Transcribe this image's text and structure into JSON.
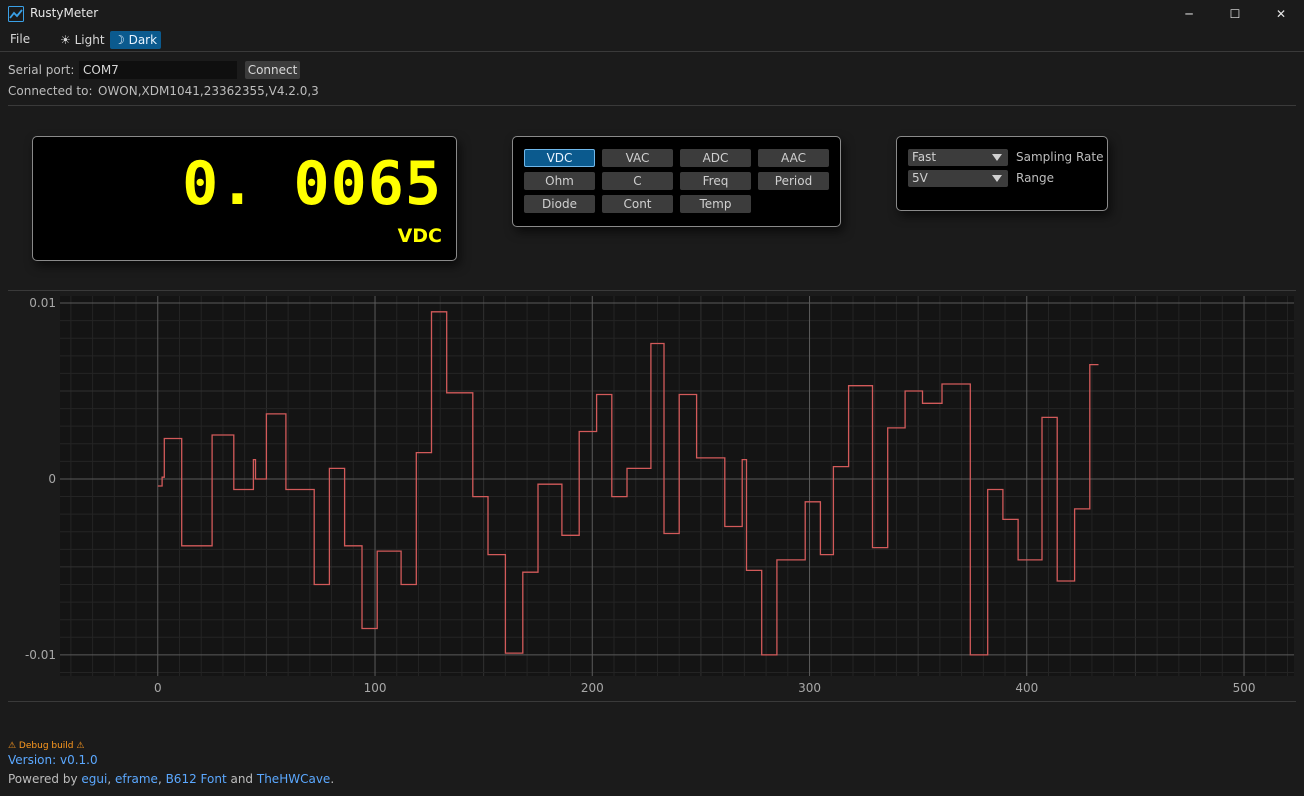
{
  "window": {
    "title": "RustyMeter",
    "minimize_glyph": "─",
    "maximize_glyph": "☐",
    "close_glyph": "✕"
  },
  "menu": {
    "file": "File",
    "light": "☀ Light",
    "dark": "☽ Dark"
  },
  "connection": {
    "serial_label": "Serial port:",
    "serial_value": "COM7",
    "connect_label": "Connect",
    "connected_label": "Connected to:",
    "connected_value": "OWON,XDM1041,23362355,V4.2.0,3"
  },
  "reading": {
    "value": "0. 0065",
    "unit": "VDC",
    "color": "#ffff00"
  },
  "modes": [
    {
      "label": "VDC",
      "active": true
    },
    {
      "label": "VAC",
      "active": false
    },
    {
      "label": "ADC",
      "active": false
    },
    {
      "label": "AAC",
      "active": false
    },
    {
      "label": "Ohm",
      "active": false
    },
    {
      "label": "C",
      "active": false
    },
    {
      "label": "Freq",
      "active": false
    },
    {
      "label": "Period",
      "active": false
    },
    {
      "label": "Diode",
      "active": false
    },
    {
      "label": "Cont",
      "active": false
    },
    {
      "label": "Temp",
      "active": false
    }
  ],
  "settings": {
    "sampling_rate_value": "Fast",
    "sampling_rate_label": "Sampling Rate",
    "range_value": "5V",
    "range_label": "Range"
  },
  "footer": {
    "debug_build": "⚠ Debug build ⚠",
    "version": "Version: v0.1.0",
    "powered_prefix": "Powered by ",
    "egui": "egui",
    "comma1": ", ",
    "eframe": "eframe",
    "comma2": ", ",
    "b612": "B612 Font",
    "and": " and ",
    "thehwcave": "TheHWCave",
    "period": "."
  },
  "chart_data": {
    "type": "line",
    "series": [
      {
        "color": "#d25a5a",
        "points": [
          [
            0,
            -0.0004
          ],
          [
            2,
            -0.0004
          ],
          [
            2,
            0.0001
          ],
          [
            3,
            0.0001
          ],
          [
            3,
            0.0023
          ],
          [
            11,
            0.0023
          ],
          [
            11,
            -0.0038
          ],
          [
            25,
            -0.0038
          ],
          [
            25,
            0.0025
          ],
          [
            35,
            0.0025
          ],
          [
            35,
            -0.0006
          ],
          [
            42,
            -0.0006
          ],
          [
            42,
            -0.0006
          ],
          [
            44,
            -0.0006
          ],
          [
            44,
            0.0011
          ],
          [
            45,
            0.0011
          ],
          [
            45,
            0.0
          ],
          [
            50,
            0.0
          ],
          [
            50,
            0.0037
          ],
          [
            59,
            0.0037
          ],
          [
            59,
            -0.0006
          ],
          [
            72,
            -0.0006
          ],
          [
            72,
            -0.006
          ],
          [
            79,
            -0.006
          ],
          [
            79,
            0.0006
          ],
          [
            86,
            0.0006
          ],
          [
            86,
            -0.0038
          ],
          [
            94,
            -0.0038
          ],
          [
            94,
            -0.0085
          ],
          [
            101,
            -0.0085
          ],
          [
            101,
            -0.0041
          ],
          [
            112,
            -0.0041
          ],
          [
            112,
            -0.006
          ],
          [
            119,
            -0.006
          ],
          [
            119,
            0.0015
          ],
          [
            126,
            0.0015
          ],
          [
            126,
            0.0095
          ],
          [
            133,
            0.0095
          ],
          [
            133,
            0.0049
          ],
          [
            145,
            0.0049
          ],
          [
            145,
            -0.001
          ],
          [
            152,
            -0.001
          ],
          [
            152,
            -0.0043
          ],
          [
            160,
            -0.0043
          ],
          [
            160,
            -0.0099
          ],
          [
            168,
            -0.0099
          ],
          [
            168,
            -0.0053
          ],
          [
            175,
            -0.0053
          ],
          [
            175,
            -0.0003
          ],
          [
            186,
            -0.0003
          ],
          [
            186,
            -0.0032
          ],
          [
            194,
            -0.0032
          ],
          [
            194,
            0.0027
          ],
          [
            202,
            0.0027
          ],
          [
            202,
            0.0048
          ],
          [
            209,
            0.0048
          ],
          [
            209,
            -0.001
          ],
          [
            216,
            -0.001
          ],
          [
            216,
            0.0006
          ],
          [
            227,
            0.0006
          ],
          [
            227,
            0.0077
          ],
          [
            233,
            0.0077
          ],
          [
            233,
            -0.0031
          ],
          [
            240,
            -0.0031
          ],
          [
            240,
            0.0048
          ],
          [
            248,
            0.0048
          ],
          [
            248,
            0.0012
          ],
          [
            261,
            0.0012
          ],
          [
            261,
            -0.0027
          ],
          [
            269,
            -0.0027
          ],
          [
            269,
            0.0011
          ],
          [
            271,
            0.0011
          ],
          [
            271,
            -0.0052
          ],
          [
            278,
            -0.0052
          ],
          [
            278,
            -0.01
          ],
          [
            285,
            -0.01
          ],
          [
            285,
            -0.0046
          ],
          [
            298,
            -0.0046
          ],
          [
            298,
            -0.0013
          ],
          [
            305,
            -0.0013
          ],
          [
            305,
            -0.0043
          ],
          [
            311,
            -0.0043
          ],
          [
            311,
            0.0007
          ],
          [
            318,
            0.0007
          ],
          [
            318,
            0.0053
          ],
          [
            329,
            0.0053
          ],
          [
            329,
            -0.0039
          ],
          [
            336,
            -0.0039
          ],
          [
            336,
            0.0029
          ],
          [
            344,
            0.0029
          ],
          [
            344,
            0.005
          ],
          [
            352,
            0.005
          ],
          [
            352,
            0.0043
          ],
          [
            361,
            0.0043
          ],
          [
            361,
            0.0054
          ],
          [
            374,
            0.0054
          ],
          [
            374,
            -0.01
          ],
          [
            382,
            -0.01
          ],
          [
            382,
            -0.0006
          ],
          [
            389,
            -0.0006
          ],
          [
            389,
            -0.0023
          ],
          [
            396,
            -0.0023
          ],
          [
            396,
            -0.0046
          ],
          [
            407,
            -0.0046
          ],
          [
            407,
            0.0035
          ],
          [
            414,
            0.0035
          ],
          [
            414,
            -0.0058
          ],
          [
            422,
            -0.0058
          ],
          [
            422,
            -0.0017
          ],
          [
            429,
            -0.0017
          ],
          [
            429,
            0.0065
          ],
          [
            433,
            0.0065
          ]
        ]
      }
    ],
    "x_ticks": [
      "0",
      "100",
      "200",
      "300",
      "400",
      "500"
    ],
    "y_ticks": [
      "0.01",
      "0",
      "-0.01"
    ],
    "xlim": [
      -45,
      523
    ],
    "ylim": [
      -0.0112,
      0.0104
    ],
    "grid": true
  }
}
